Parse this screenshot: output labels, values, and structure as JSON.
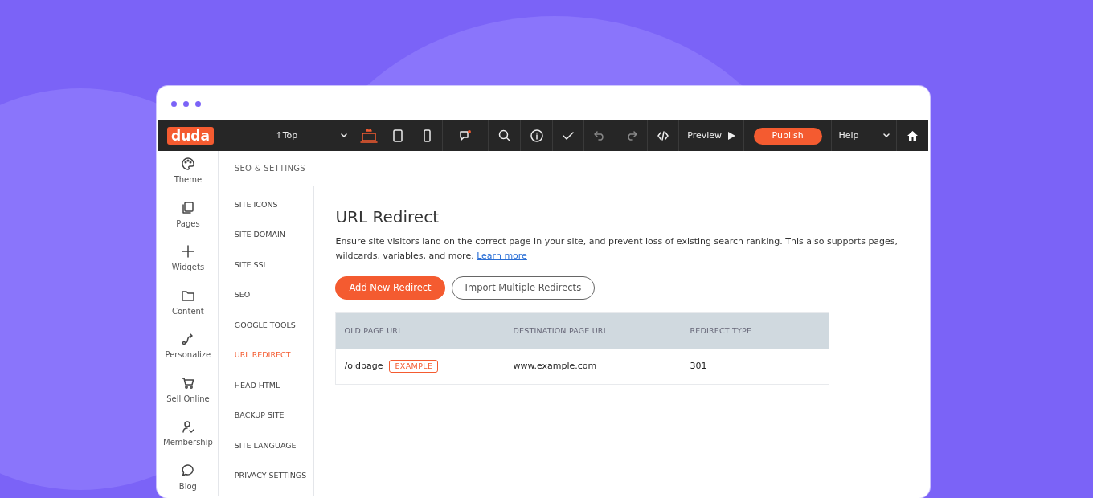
{
  "toolbar": {
    "logo": "duda",
    "page_select": "↑Top",
    "devices": [
      {
        "selected": true
      },
      {
        "selected": false
      },
      {
        "selected": false
      }
    ],
    "preview": "Preview",
    "publish": "Publish",
    "help": "Help"
  },
  "sidebar": {
    "items": [
      {
        "label": "Theme"
      },
      {
        "label": "Pages"
      },
      {
        "label": "Widgets"
      },
      {
        "label": "Content"
      },
      {
        "label": "Personalize"
      },
      {
        "label": "Sell Online"
      },
      {
        "label": "Membership"
      },
      {
        "label": "Blog"
      }
    ]
  },
  "settings": {
    "title": "SEO & SETTINGS",
    "items": [
      {
        "label": "SITE ICONS",
        "selected": false
      },
      {
        "label": "SITE DOMAIN",
        "selected": false
      },
      {
        "label": "SITE SSL",
        "selected": false
      },
      {
        "label": "SEO",
        "selected": false
      },
      {
        "label": "GOOGLE TOOLS",
        "selected": false
      },
      {
        "label": "URL REDIRECT",
        "selected": true
      },
      {
        "label": "HEAD HTML",
        "selected": false
      },
      {
        "label": "BACKUP SITE",
        "selected": false
      },
      {
        "label": "SITE LANGUAGE",
        "selected": false
      },
      {
        "label": "PRIVACY SETTINGS",
        "selected": false
      }
    ]
  },
  "content": {
    "title": "URL Redirect",
    "description": "Ensure site visitors land on the correct page in your site, and prevent loss of existing search ranking. This also supports pages, wildcards, variables, and more.",
    "link": "Learn more",
    "buttons": [
      {
        "label": "Add New Redirect",
        "kind": "primary"
      },
      {
        "label": "Import Multiple Redirects",
        "kind": "outline"
      }
    ],
    "table": {
      "columns": [
        "OLD PAGE URL",
        "DESTINATION PAGE URL",
        "REDIRECT TYPE"
      ],
      "rows": [
        {
          "cells": [
            "/oldpage",
            "www.example.com",
            "301"
          ],
          "tag": "EXAMPLE"
        }
      ]
    }
  }
}
